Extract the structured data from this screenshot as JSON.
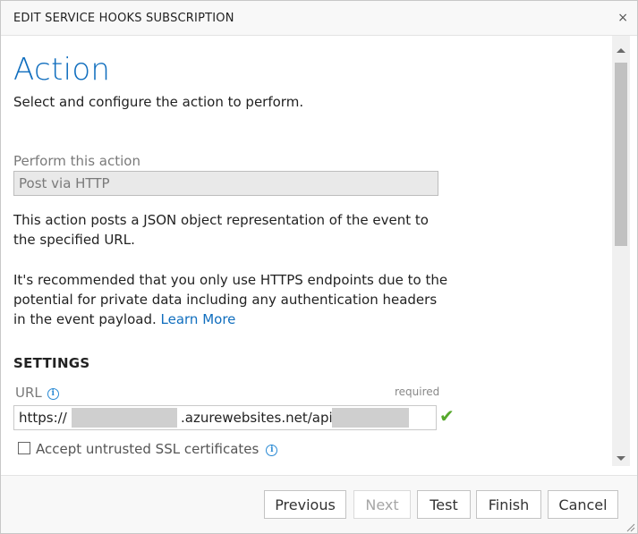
{
  "dialog": {
    "title": "EDIT SERVICE HOOKS SUBSCRIPTION",
    "close_icon": "×"
  },
  "action": {
    "heading": "Action",
    "lead": "Select and configure the action to perform.",
    "perform_label": "Perform this action",
    "perform_value": "Post via HTTP",
    "description": "This action posts a JSON object representation of the event to the specified URL.",
    "recommendation": "It's recommended that you only use HTTPS endpoints due to the potential for private data including any authentication headers in the event payload.",
    "learn_more": "Learn More"
  },
  "settings": {
    "heading": "SETTINGS",
    "url_label": "URL",
    "url_required": "required",
    "url_prefix": "https://",
    "url_middle": ".azurewebsites.net/api/",
    "accept_ssl_label": "Accept untrusted SSL certificates",
    "accept_ssl_checked": false
  },
  "buttons": {
    "previous": "Previous",
    "next": "Next",
    "test": "Test",
    "finish": "Finish",
    "cancel": "Cancel"
  },
  "colors": {
    "accent": "#106ebe",
    "valid": "#56a82c",
    "info": "#2a8ad4"
  },
  "icons": {
    "close": "close-icon",
    "info": "info-icon",
    "valid": "checkmark-icon",
    "resize": "resize-grip-icon"
  }
}
